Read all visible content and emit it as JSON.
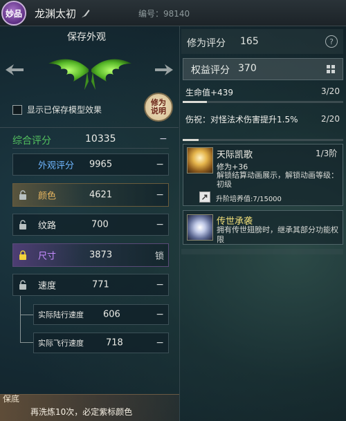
{
  "header": {
    "rarity_badge": "妙品",
    "item_name": "龙渊太初",
    "serial_label": "编号：98140"
  },
  "preview": {
    "title": "保存外观",
    "show_saved_model_label": "显示已保存模型效果",
    "repair_badge": "修为说明"
  },
  "total": {
    "label": "综合评分",
    "value": "10335",
    "minus": "−"
  },
  "stats": {
    "appearance": {
      "label": "外观评分",
      "value": "9965",
      "action": "−"
    },
    "color": {
      "label": "颜色",
      "value": "4621",
      "action": "−"
    },
    "texture": {
      "label": "纹路",
      "value": "700",
      "action": "−"
    },
    "size": {
      "label": "尺寸",
      "value": "3873",
      "action": "锁"
    },
    "speed": {
      "label": "速度",
      "value": "771",
      "action": "−"
    },
    "land_speed": {
      "label": "实际陆行速度",
      "value": "606",
      "action": "−"
    },
    "fly_speed": {
      "label": "实际飞行速度",
      "value": "718",
      "action": "−"
    }
  },
  "bottom": {
    "guarantee_label": "保底",
    "guarantee_text": "再洗炼10次，必定紫标颜色"
  },
  "right": {
    "cultivation_label": "修为评分",
    "cultivation_value": "165",
    "help": "?",
    "equity_label": "权益评分",
    "equity_value": "370",
    "hp": {
      "label": "生命值+439",
      "count": "3/20",
      "progress": 0.15
    },
    "damage": {
      "label": "伤祝：对怪法术伤害提升1.5%",
      "count": "2/20",
      "progress": 0.1
    },
    "skill1": {
      "name": "天际凯歌",
      "tier": "1/3阶",
      "bonus": "修为+36",
      "desc": "解锁结算动画展示，解锁动画等级：初级",
      "upgrade": "升阶培养值:7/15000"
    },
    "skill2": {
      "name": "传世承袭",
      "desc": "拥有传世翅膀时，继承其部分功能权限"
    }
  },
  "colors": {
    "accent_green": "#53c15f",
    "appearance_blue": "#6fb6ff",
    "color_gold": "#e8b660",
    "size_purple": "#c68cff",
    "skill2_yellow": "#f2e07a"
  }
}
